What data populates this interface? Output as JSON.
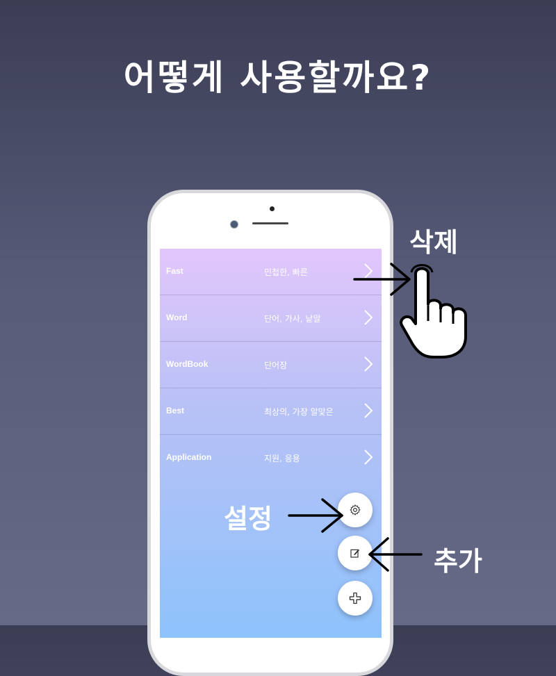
{
  "headline": "어떻게 사용할까요?",
  "annotations": {
    "delete": "삭제",
    "settings": "설정",
    "add": "추가"
  },
  "list": [
    {
      "en": "Fast",
      "ko": "민첩한, 빠른"
    },
    {
      "en": "Word",
      "ko": "단어, 가사, 낱말"
    },
    {
      "en": "WordBook",
      "ko": "단어장"
    },
    {
      "en": "Best",
      "ko": "최상의, 가장 알맞은"
    },
    {
      "en": "Application",
      "ko": "지원, 응용"
    }
  ],
  "icons": {
    "row_chevron": "chevron-right-icon",
    "settings_fab": "gear-icon",
    "edit_fab": "edit-note-icon",
    "add_fab": "plus-icon",
    "swipe_hand": "pointing-hand-icon"
  },
  "colors": {
    "screen_top": "#e2c6fb",
    "screen_bottom": "#8ec2fb",
    "background": "#575b78"
  }
}
